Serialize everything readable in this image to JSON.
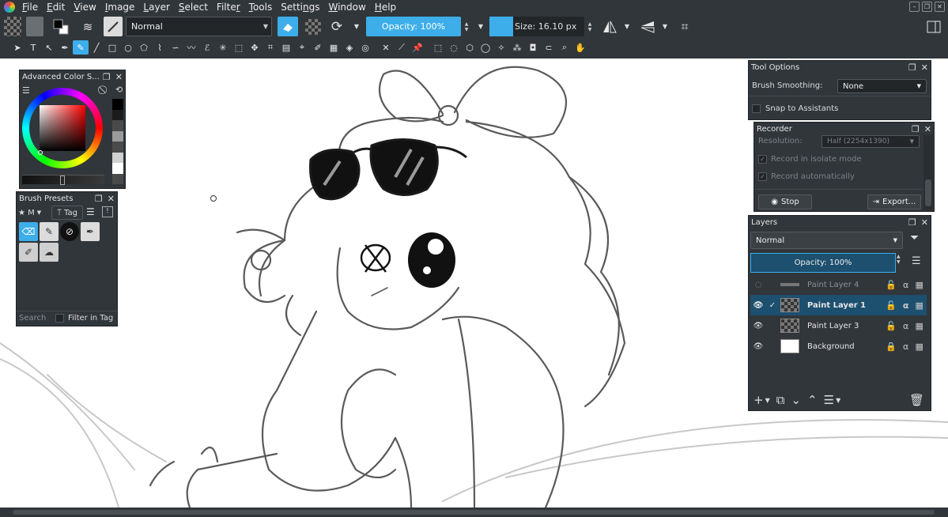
{
  "menubar": {
    "items": [
      {
        "pre": "",
        "u": "F",
        "post": "ile"
      },
      {
        "pre": "",
        "u": "E",
        "post": "dit"
      },
      {
        "pre": "",
        "u": "V",
        "post": "iew"
      },
      {
        "pre": "",
        "u": "I",
        "post": "mage"
      },
      {
        "pre": "",
        "u": "L",
        "post": "ayer"
      },
      {
        "pre": "",
        "u": "S",
        "post": "elect"
      },
      {
        "pre": "Filte",
        "u": "r",
        "post": ""
      },
      {
        "pre": "",
        "u": "T",
        "post": "ools"
      },
      {
        "pre": "Setti",
        "u": "n",
        "post": "gs"
      },
      {
        "pre": "",
        "u": "W",
        "post": "indow"
      },
      {
        "pre": "",
        "u": "H",
        "post": "elp"
      }
    ]
  },
  "toolbar": {
    "blend_mode": "Normal",
    "opacity": "Opacity: 100%",
    "size": "Size: 16.10 px"
  },
  "color_selector": {
    "title": "Advanced Color S...",
    "shades": [
      "#000000",
      "#1c1c1c",
      "#4a4a4a",
      "#9a9a9a",
      "#4a4a4a",
      "#d0d0d0",
      "#ffffff",
      "#4a4a4a"
    ]
  },
  "brush_presets": {
    "title": "Brush Presets",
    "tag_label": "Tag",
    "star_label": "★ M",
    "search_placeholder": "Search",
    "filter_label": "Filter in Tag"
  },
  "tool_options": {
    "title": "Tool Options",
    "smoothing_label": "Brush Smoothing:",
    "smoothing_value": "None",
    "snap_label": "Snap to Assistants"
  },
  "recorder": {
    "title": "Recorder",
    "resolution_label": "Resolution:",
    "resolution_value": "Half (2254x1390)",
    "isolate_label": "Record in isolate mode",
    "auto_label": "Record automatically",
    "stop_label": "Stop",
    "export_label": "Export..."
  },
  "layers": {
    "title": "Layers",
    "blend_mode": "Normal",
    "opacity": "Opacity:  100%",
    "items": [
      {
        "name": "Paint Layer 4",
        "visible": false,
        "selected": false
      },
      {
        "name": "Paint Layer 1",
        "visible": true,
        "selected": true
      },
      {
        "name": "Paint Layer 3",
        "visible": true,
        "selected": false
      },
      {
        "name": "Background",
        "visible": true,
        "selected": false
      }
    ]
  },
  "colors": {
    "accent": "#3daee9",
    "panel_bg": "#31363b",
    "selected_row": "#1d4f6f"
  }
}
